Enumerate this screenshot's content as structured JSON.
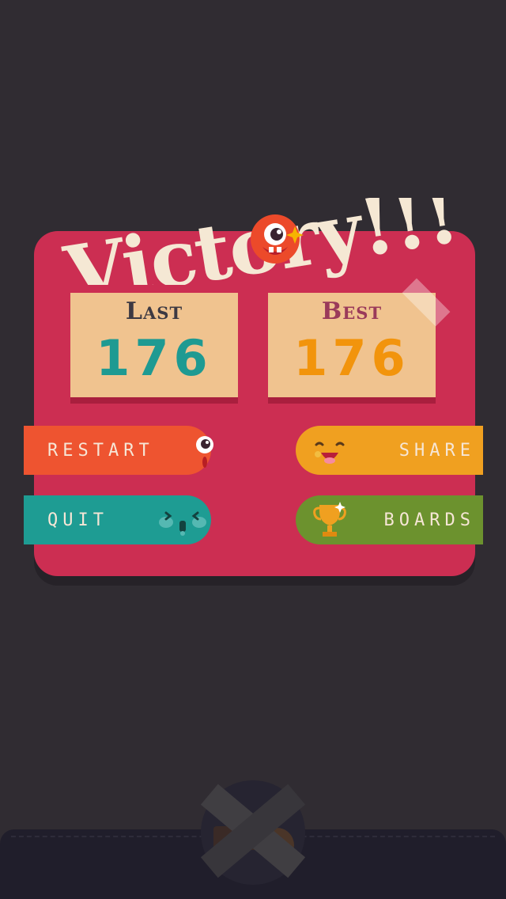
{
  "title": "Victory!!!",
  "scores": {
    "last_label": "Last",
    "last_value": "176",
    "best_label": "Best",
    "best_value": "176"
  },
  "buttons": {
    "restart": "RESTART",
    "share": "SHARE",
    "quit": "QUIT",
    "boards": "BOARDS"
  },
  "icons": {
    "title_face": "cyclops-monster-face-icon",
    "restart": "surprised-face-icon",
    "share": "happy-face-icon",
    "quit": "sleepy-face-icon",
    "boards": "trophy-icon",
    "close": "x-close-icon"
  },
  "colors": {
    "background": "#302c32",
    "panel": "#cc2e52",
    "card": "#f0c38f",
    "restart": "#ee5430",
    "share": "#f0a020",
    "quit": "#1e9c93",
    "boards": "#6c922e",
    "last_value": "#1e9a92",
    "best_value": "#f2940c"
  }
}
